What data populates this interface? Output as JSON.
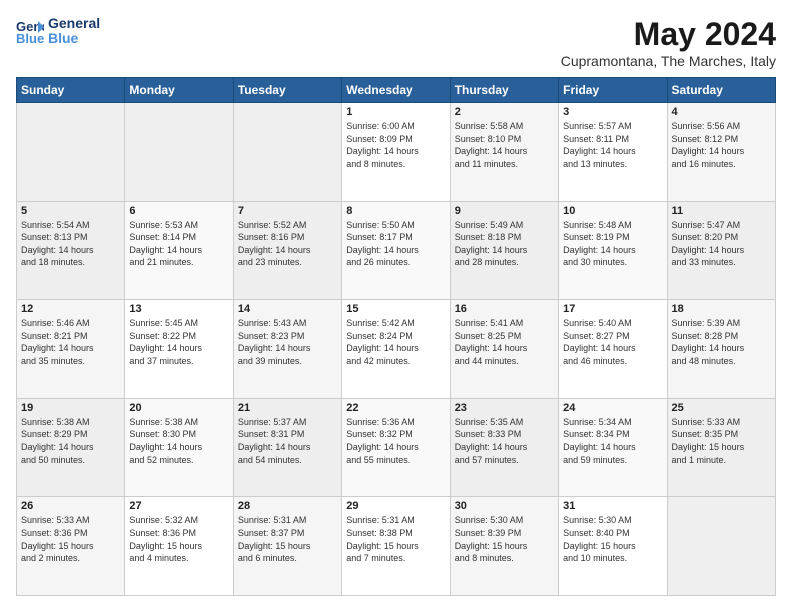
{
  "logo": {
    "line1": "General",
    "line2": "Blue"
  },
  "title": "May 2024",
  "subtitle": "Cupramontana, The Marches, Italy",
  "header_days": [
    "Sunday",
    "Monday",
    "Tuesday",
    "Wednesday",
    "Thursday",
    "Friday",
    "Saturday"
  ],
  "weeks": [
    [
      {
        "num": "",
        "info": ""
      },
      {
        "num": "",
        "info": ""
      },
      {
        "num": "",
        "info": ""
      },
      {
        "num": "1",
        "info": "Sunrise: 6:00 AM\nSunset: 8:09 PM\nDaylight: 14 hours\nand 8 minutes."
      },
      {
        "num": "2",
        "info": "Sunrise: 5:58 AM\nSunset: 8:10 PM\nDaylight: 14 hours\nand 11 minutes."
      },
      {
        "num": "3",
        "info": "Sunrise: 5:57 AM\nSunset: 8:11 PM\nDaylight: 14 hours\nand 13 minutes."
      },
      {
        "num": "4",
        "info": "Sunrise: 5:56 AM\nSunset: 8:12 PM\nDaylight: 14 hours\nand 16 minutes."
      }
    ],
    [
      {
        "num": "5",
        "info": "Sunrise: 5:54 AM\nSunset: 8:13 PM\nDaylight: 14 hours\nand 18 minutes."
      },
      {
        "num": "6",
        "info": "Sunrise: 5:53 AM\nSunset: 8:14 PM\nDaylight: 14 hours\nand 21 minutes."
      },
      {
        "num": "7",
        "info": "Sunrise: 5:52 AM\nSunset: 8:16 PM\nDaylight: 14 hours\nand 23 minutes."
      },
      {
        "num": "8",
        "info": "Sunrise: 5:50 AM\nSunset: 8:17 PM\nDaylight: 14 hours\nand 26 minutes."
      },
      {
        "num": "9",
        "info": "Sunrise: 5:49 AM\nSunset: 8:18 PM\nDaylight: 14 hours\nand 28 minutes."
      },
      {
        "num": "10",
        "info": "Sunrise: 5:48 AM\nSunset: 8:19 PM\nDaylight: 14 hours\nand 30 minutes."
      },
      {
        "num": "11",
        "info": "Sunrise: 5:47 AM\nSunset: 8:20 PM\nDaylight: 14 hours\nand 33 minutes."
      }
    ],
    [
      {
        "num": "12",
        "info": "Sunrise: 5:46 AM\nSunset: 8:21 PM\nDaylight: 14 hours\nand 35 minutes."
      },
      {
        "num": "13",
        "info": "Sunrise: 5:45 AM\nSunset: 8:22 PM\nDaylight: 14 hours\nand 37 minutes."
      },
      {
        "num": "14",
        "info": "Sunrise: 5:43 AM\nSunset: 8:23 PM\nDaylight: 14 hours\nand 39 minutes."
      },
      {
        "num": "15",
        "info": "Sunrise: 5:42 AM\nSunset: 8:24 PM\nDaylight: 14 hours\nand 42 minutes."
      },
      {
        "num": "16",
        "info": "Sunrise: 5:41 AM\nSunset: 8:25 PM\nDaylight: 14 hours\nand 44 minutes."
      },
      {
        "num": "17",
        "info": "Sunrise: 5:40 AM\nSunset: 8:27 PM\nDaylight: 14 hours\nand 46 minutes."
      },
      {
        "num": "18",
        "info": "Sunrise: 5:39 AM\nSunset: 8:28 PM\nDaylight: 14 hours\nand 48 minutes."
      }
    ],
    [
      {
        "num": "19",
        "info": "Sunrise: 5:38 AM\nSunset: 8:29 PM\nDaylight: 14 hours\nand 50 minutes."
      },
      {
        "num": "20",
        "info": "Sunrise: 5:38 AM\nSunset: 8:30 PM\nDaylight: 14 hours\nand 52 minutes."
      },
      {
        "num": "21",
        "info": "Sunrise: 5:37 AM\nSunset: 8:31 PM\nDaylight: 14 hours\nand 54 minutes."
      },
      {
        "num": "22",
        "info": "Sunrise: 5:36 AM\nSunset: 8:32 PM\nDaylight: 14 hours\nand 55 minutes."
      },
      {
        "num": "23",
        "info": "Sunrise: 5:35 AM\nSunset: 8:33 PM\nDaylight: 14 hours\nand 57 minutes."
      },
      {
        "num": "24",
        "info": "Sunrise: 5:34 AM\nSunset: 8:34 PM\nDaylight: 14 hours\nand 59 minutes."
      },
      {
        "num": "25",
        "info": "Sunrise: 5:33 AM\nSunset: 8:35 PM\nDaylight: 15 hours\nand 1 minute."
      }
    ],
    [
      {
        "num": "26",
        "info": "Sunrise: 5:33 AM\nSunset: 8:36 PM\nDaylight: 15 hours\nand 2 minutes."
      },
      {
        "num": "27",
        "info": "Sunrise: 5:32 AM\nSunset: 8:36 PM\nDaylight: 15 hours\nand 4 minutes."
      },
      {
        "num": "28",
        "info": "Sunrise: 5:31 AM\nSunset: 8:37 PM\nDaylight: 15 hours\nand 6 minutes."
      },
      {
        "num": "29",
        "info": "Sunrise: 5:31 AM\nSunset: 8:38 PM\nDaylight: 15 hours\nand 7 minutes."
      },
      {
        "num": "30",
        "info": "Sunrise: 5:30 AM\nSunset: 8:39 PM\nDaylight: 15 hours\nand 8 minutes."
      },
      {
        "num": "31",
        "info": "Sunrise: 5:30 AM\nSunset: 8:40 PM\nDaylight: 15 hours\nand 10 minutes."
      },
      {
        "num": "",
        "info": ""
      }
    ]
  ]
}
